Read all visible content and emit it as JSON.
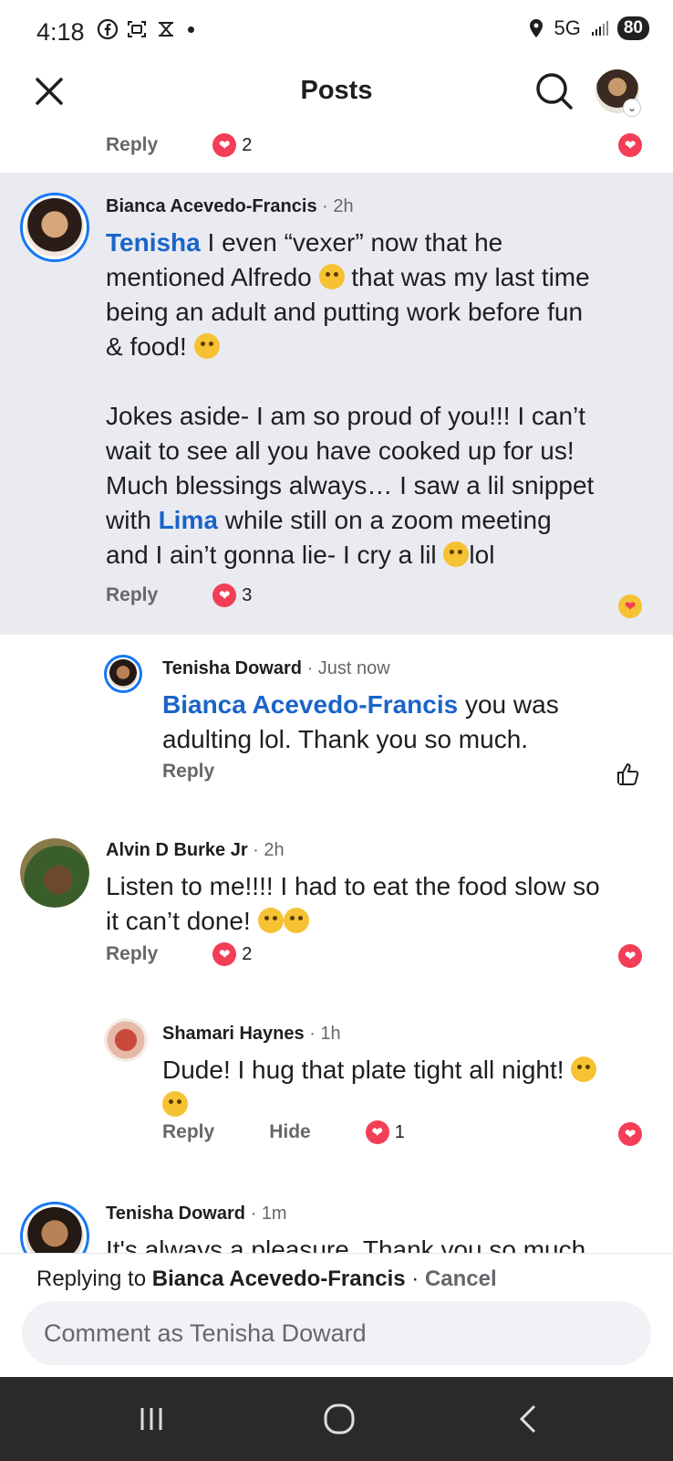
{
  "status_bar": {
    "time": "4:18",
    "network": "5G",
    "battery": "80"
  },
  "header": {
    "title": "Posts"
  },
  "comments": [
    {
      "actions": {
        "reply": "Reply",
        "reaction_count": "2"
      }
    },
    {
      "author": "Bianca Acevedo-Francis",
      "time": "· 2h",
      "mention": "Tenisha",
      "line1": " I even “vexer” now that he",
      "line2a": "mentioned Alfredo ",
      "line2b": " that was my last time",
      "line3": "being an adult and putting work before fun",
      "line4": "& food! ",
      "line5": "Jokes aside- I am so proud of you!!! I can’t",
      "line6": "wait to see all you have cooked up for us!",
      "line7": "Much blessings always… I saw a lil snippet",
      "line8a": "with ",
      "line8_mention": "Lima",
      "line8b": " while still on a zoom  meeting",
      "line9a": "and I ain’t gonna lie- I cry a lil ",
      "line9b": "lol",
      "actions": {
        "reply": "Reply",
        "reaction_count": "3"
      }
    },
    {
      "author": "Tenisha Doward",
      "time": "· Just now",
      "mention": "Bianca Acevedo-Francis",
      "line1": " you was",
      "line2": "adulting lol.  Thank you so much.",
      "actions": {
        "reply": "Reply"
      }
    },
    {
      "author": "Alvin D Burke Jr",
      "time": "· 2h",
      "line1": "Listen to me!!!! I had to eat the food slow so",
      "line2": "it can’t done! ",
      "actions": {
        "reply": "Reply",
        "reaction_count": "2"
      }
    },
    {
      "author": "Shamari Haynes",
      "time": "· 1h",
      "line1": "Dude! I hug that plate tight all night! ",
      "actions": {
        "reply": "Reply",
        "hide": "Hide",
        "reaction_count": "1"
      }
    },
    {
      "author": "Tenisha Doward",
      "time": "· 1m",
      "line1": "It's always a pleasure. Thank you so much"
    }
  ],
  "reply_bar": {
    "prefix": "Replying to ",
    "target": "Bianca Acevedo-Francis",
    "separator": " · ",
    "cancel": "Cancel",
    "placeholder": "Comment as Tenisha Doward"
  },
  "colors": {
    "accent": "#1877f2",
    "mention": "#1a64c9",
    "heart": "#f33e58",
    "highlight_bg": "#e9ebf1"
  },
  "icons": [
    "facebook-icon",
    "screenshot-icon",
    "gallery-icon",
    "location-icon",
    "signal-icon",
    "close-icon",
    "search-icon",
    "heart-icon",
    "care-icon",
    "like-icon",
    "recents-icon",
    "home-icon",
    "back-icon"
  ]
}
